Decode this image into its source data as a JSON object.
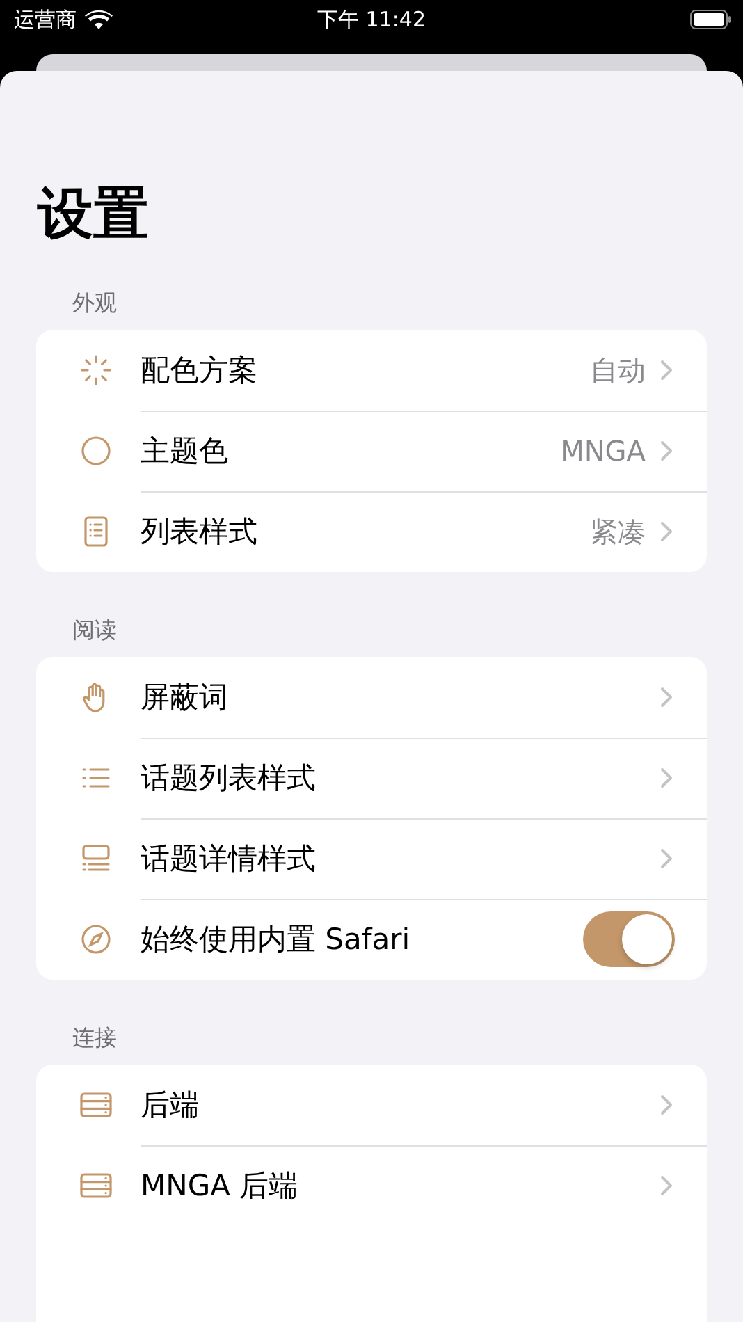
{
  "status_bar": {
    "carrier": "运营商",
    "time": "下午 11:42"
  },
  "title": "设置",
  "sections": [
    {
      "header": "外观",
      "rows": [
        {
          "kind": "link",
          "label": "配色方案",
          "value": "自动"
        },
        {
          "kind": "link",
          "label": "主题色",
          "value": "MNGA"
        },
        {
          "kind": "link",
          "label": "列表样式",
          "value": "紧凑"
        }
      ]
    },
    {
      "header": "阅读",
      "rows": [
        {
          "kind": "link",
          "label": "屏蔽词"
        },
        {
          "kind": "link",
          "label": "话题列表样式"
        },
        {
          "kind": "link",
          "label": "话题详情样式"
        },
        {
          "kind": "toggle",
          "label": "始终使用内置 Safari",
          "on": true
        }
      ]
    },
    {
      "header": "连接",
      "rows": [
        {
          "kind": "link",
          "label": "后端"
        },
        {
          "kind": "link",
          "label": "MNGA 后端"
        }
      ],
      "more_below": true
    }
  ]
}
